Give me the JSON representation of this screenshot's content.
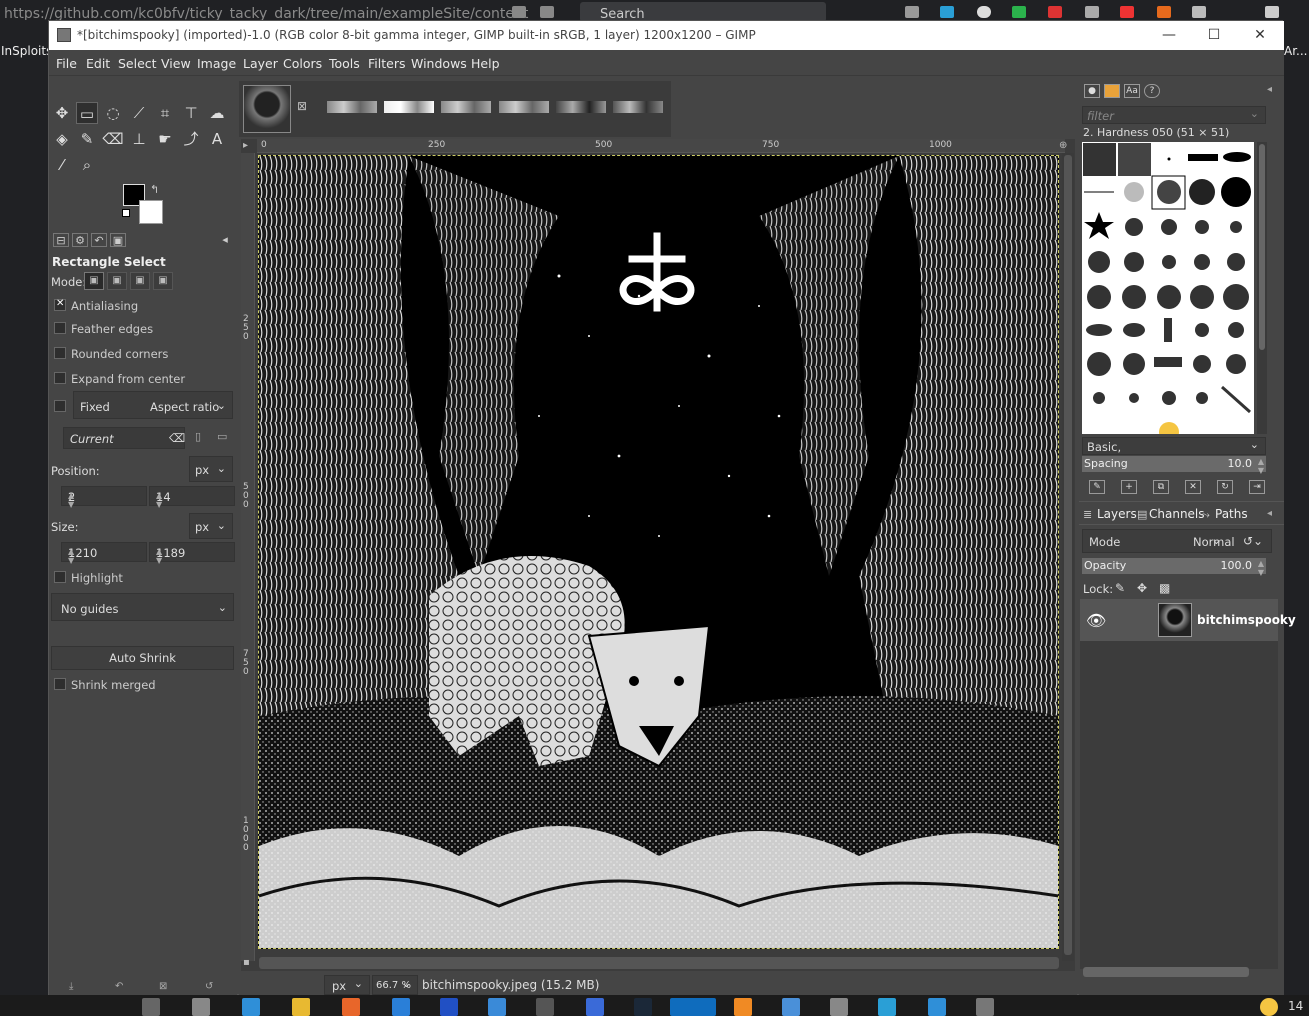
{
  "browser": {
    "url": "https://github.com/kc0bfv/ticky_tacky_dark/tree/main/exampleSite/content",
    "search_label": "Search",
    "left_tab": "InSploits",
    "right_tab": "Ar..."
  },
  "window": {
    "title": "*[bitchimspooky] (imported)-1.0 (RGB color 8-bit gamma integer, GIMP built-in sRGB, 1 layer) 1200x1200 – GIMP",
    "minimize": "—",
    "maximize": "☐",
    "close": "✕"
  },
  "menu": [
    "File",
    "Edit",
    "Select",
    "View",
    "Image",
    "Layer",
    "Colors",
    "Tools",
    "Filters",
    "Windows",
    "Help"
  ],
  "tool_options": {
    "title": "Rectangle Select",
    "mode_label": "Mode:",
    "antialiasing": "Antialiasing",
    "feather_edges": "Feather edges",
    "rounded_corners": "Rounded corners",
    "expand_from_center": "Expand from center",
    "fixed": "Fixed",
    "aspect_ratio": "Aspect ratio",
    "current": "Current",
    "position_label": "Position:",
    "position_unit": "px",
    "position_x": "2",
    "position_y": "14",
    "size_label": "Size:",
    "size_unit": "px",
    "size_w": "1210",
    "size_h": "1189",
    "highlight": "Highlight",
    "guides": "No guides",
    "auto_shrink": "Auto Shrink",
    "shrink_merged": "Shrink merged"
  },
  "rulers": {
    "top": [
      "0",
      "250",
      "500",
      "750",
      "1000"
    ],
    "left": [
      "250",
      "500",
      "750",
      "1000"
    ]
  },
  "status": {
    "unit": "px",
    "zoom": "66.7 %",
    "file": "bitchimspooky.jpeg (15.2 MB)"
  },
  "brushes": {
    "filter_placeholder": "filter",
    "selected": "2. Hardness 050 (51 × 51)",
    "preset": "Basic,",
    "spacing_label": "Spacing",
    "spacing_value": "10.0"
  },
  "layers": {
    "tabs": [
      "Layers",
      "Channels",
      "Paths"
    ],
    "mode_label": "Mode",
    "mode_value": "Normal",
    "opacity_label": "Opacity",
    "opacity_value": "100.0",
    "lock_label": "Lock:",
    "layer_name": "bitchimspooky"
  },
  "taskbar": {
    "time": "14"
  }
}
